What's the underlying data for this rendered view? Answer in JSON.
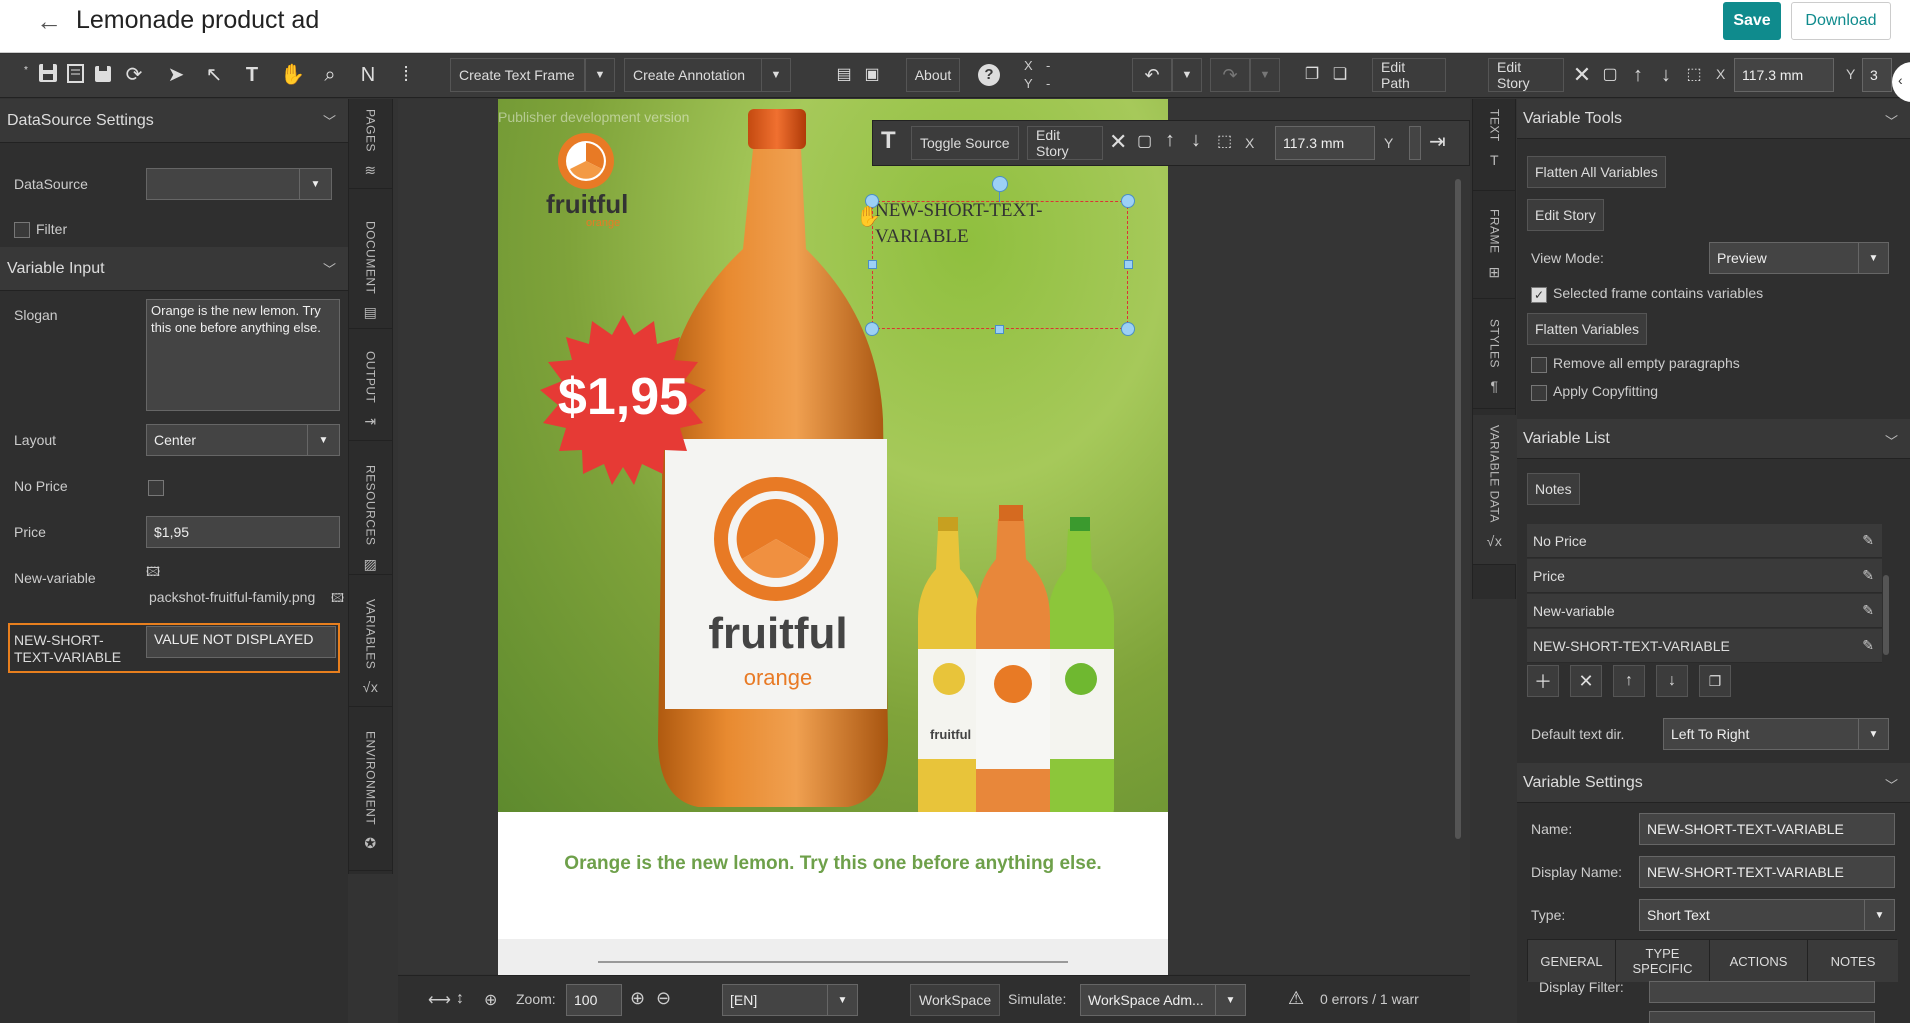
{
  "header": {
    "title": "Lemonade product ad",
    "save": "Save",
    "download": "Download"
  },
  "toolbar": {
    "create_text_frame": "Create Text Frame",
    "create_annotation": "Create Annotation",
    "about": "About",
    "x_label": "X",
    "y_label": "Y",
    "x_value": "-",
    "y_value": "-",
    "edit_path": "Edit Path",
    "edit_story": "Edit Story",
    "coord_x_label": "X",
    "coord_x": "117.3 mm",
    "coord_y_label": "Y",
    "coord_y": "3"
  },
  "left": {
    "datasource_head": "DataSource Settings",
    "datasource_label": "DataSource",
    "filter_label": "Filter",
    "varinput_head": "Variable Input",
    "slogan_label": "Slogan",
    "slogan_value": "Orange is the new lemon. Try this one before anything else.",
    "layout_label": "Layout",
    "layout_value": "Center",
    "noprice_label": "No Price",
    "price_label": "Price",
    "price_value": "$1,95",
    "newvar_label": "New-variable",
    "newvar_file": "packshot-fruitful-family.png",
    "short_label": "NEW-SHORT-TEXT-VARIABLE",
    "short_value": "VALUE NOT DISPLAYED"
  },
  "vtabs": {
    "pages": "PAGES",
    "document": "DOCUMENT",
    "output": "OUTPUT",
    "resources": "RESOURCES",
    "variables": "VARIABLES",
    "environment": "ENVIRONMENT",
    "text": "TEXT",
    "frame": "FRAME",
    "styles": "STYLES",
    "variable_data": "VARIABLE DATA"
  },
  "canvas": {
    "watermark": "Publisher development version",
    "frame_toolbar": {
      "toggle_source": "Toggle Source",
      "edit_story": "Edit Story",
      "x_label": "X",
      "x_value": "117.3 mm",
      "y_label": "Y"
    },
    "frame_text": "NEW-SHORT-TEXT-VARIABLE",
    "price_badge": "$1,95",
    "logo_word": "fruitful",
    "logo_sub": "orange",
    "bottle_brand": "fruitful",
    "bottle_flavor": "orange",
    "small_brand": "fruitful",
    "slogan_print": "Orange is the new lemon. Try this one before anything else."
  },
  "right": {
    "vartools_head": "Variable Tools",
    "flatten_all": "Flatten All Variables",
    "edit_story": "Edit Story",
    "view_mode_label": "View Mode:",
    "view_mode_value": "Preview",
    "selected_contains": "Selected frame contains variables",
    "flatten_vars": "Flatten Variables",
    "remove_empty": "Remove all empty paragraphs",
    "apply_copyfit": "Apply Copyfitting",
    "varlist_head": "Variable List",
    "notes_btn": "Notes",
    "variables": [
      "No Price",
      "Price",
      "New-variable",
      "NEW-SHORT-TEXT-VARIABLE"
    ],
    "default_dir_label": "Default text dir.",
    "default_dir_value": "Left To Right",
    "varsettings_head": "Variable Settings",
    "name_label": "Name:",
    "name_value": "NEW-SHORT-TEXT-VARIABLE",
    "display_name_label": "Display Name:",
    "display_name_value": "NEW-SHORT-TEXT-VARIABLE",
    "type_label": "Type:",
    "type_value": "Short Text",
    "tabs": [
      "GENERAL",
      "TYPE SPECIFIC",
      "ACTIONS",
      "NOTES"
    ],
    "display_filter_label": "Display Filter:"
  },
  "bottom": {
    "zoom_label": "Zoom:",
    "zoom_value": "100",
    "lang": "[EN]",
    "workspace": "WorkSpace",
    "simulate_label": "Simulate:",
    "simulate_value": "WorkSpace Adm...",
    "errors": "0 errors / 1 warr"
  }
}
